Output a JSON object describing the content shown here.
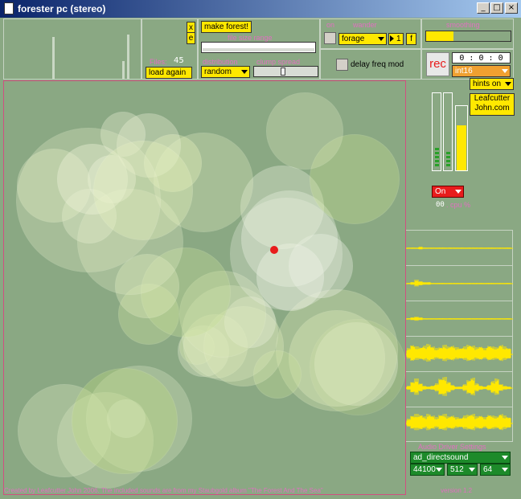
{
  "window": {
    "title": "forester pc (stereo)",
    "btn_min": "_",
    "btn_max": "□",
    "btn_close": "×"
  },
  "top": {
    "xe_x": "x",
    "xe_e": "e",
    "files_label": "Files:",
    "files_count": "45",
    "load_again": "load again",
    "make_forest": "make forest!",
    "file_size_range_label": "file size range",
    "distribution_label": "distribution",
    "distribution_value": "random",
    "clump_spread_label": "clump spread",
    "on_label": "on",
    "wander_label": "wander",
    "wander_mode": "forage",
    "wander_btn_1": "1",
    "wander_btn_f": "f",
    "delay_freq_mod": "delay freq mod",
    "smoothing_label": "smoothing",
    "smoothing_level": 0.32,
    "rec_label": "rec",
    "time_h": "0",
    "time_m": "0",
    "time_s": "0",
    "time_sep": ":",
    "rec_format": "int16"
  },
  "right": {
    "hints": "hints on",
    "credit_line1": "Leafcutter",
    "credit_line2": "John.com",
    "on_state": "On",
    "cpu_value": "00",
    "cpu_label": ". cpu %"
  },
  "audio": {
    "settings_label": "Audio Driver Settings",
    "driver": "ad_directsound",
    "rate": "44100",
    "buffer1": "512",
    "buffer2": "64"
  },
  "footer": {
    "credit": "Created by Leafcutter John 2006. The included sounds are from my Staubgold album \"The Forest And The Sea\"",
    "version": "version 1.2"
  },
  "colors": {
    "background": "#8aa883",
    "accent_yellow": "#ffe800",
    "label_pink": "#e070c0",
    "record_red": "#e81c1c",
    "driver_green": "#1d8a2a"
  }
}
